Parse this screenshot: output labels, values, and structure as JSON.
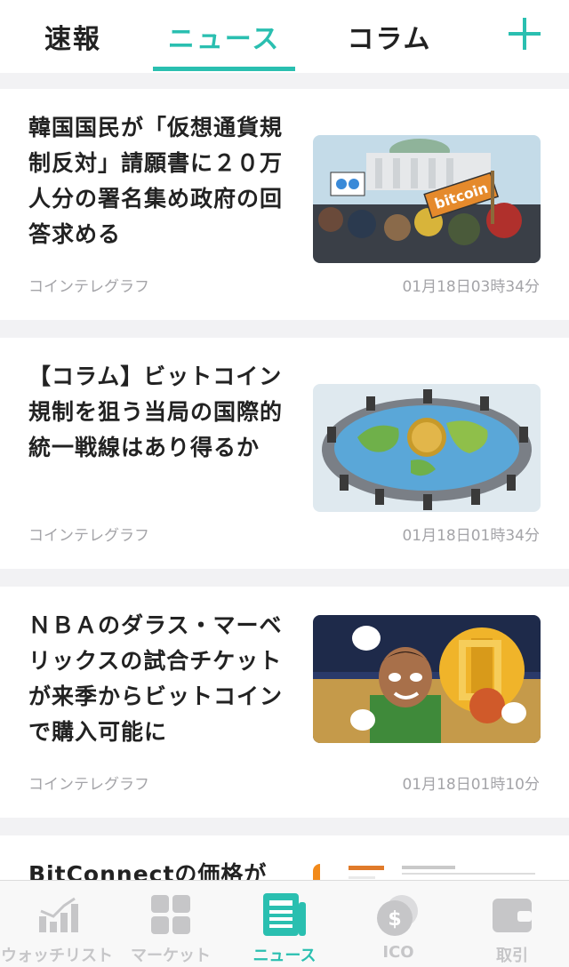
{
  "top_tabs": [
    {
      "label": "速報"
    },
    {
      "label": "ニュース"
    },
    {
      "label": "コラム"
    }
  ],
  "active_top_tab": "ニュース",
  "articles": [
    {
      "title": "韓国国民が「仮想通貨規制反対」請願書に２０万人分の署名集め政府の回答求める",
      "source": "コインテレグラフ",
      "time": "01月18日03時34分",
      "thumb_text": "bitcoin"
    },
    {
      "title": "【コラム】ビットコイン規制を狙う当局の国際的統一戦線はあり得るか",
      "source": "コインテレグラフ",
      "time": "01月18日01時34分"
    },
    {
      "title": "ＮＢＡのダラス・マーベリックスの試合チケットが来季からビットコインで購入可能に",
      "source": "コインテレグラフ",
      "time": "01月18日01時10分"
    },
    {
      "title": "BitConnectの価格が"
    }
  ],
  "bottom_nav": [
    {
      "label": "ウォッチリスト",
      "icon": "chart-icon"
    },
    {
      "label": "マーケット",
      "icon": "grid-icon"
    },
    {
      "label": "ニュース",
      "icon": "news-icon"
    },
    {
      "label": "ICO",
      "icon": "coin-icon"
    },
    {
      "label": "取引",
      "icon": "wallet-icon"
    }
  ],
  "active_bottom_nav": "ニュース",
  "colors": {
    "accent": "#2abfb0",
    "inactive": "#c6c6c8",
    "text": "#222222",
    "meta": "#a4a4a8"
  }
}
